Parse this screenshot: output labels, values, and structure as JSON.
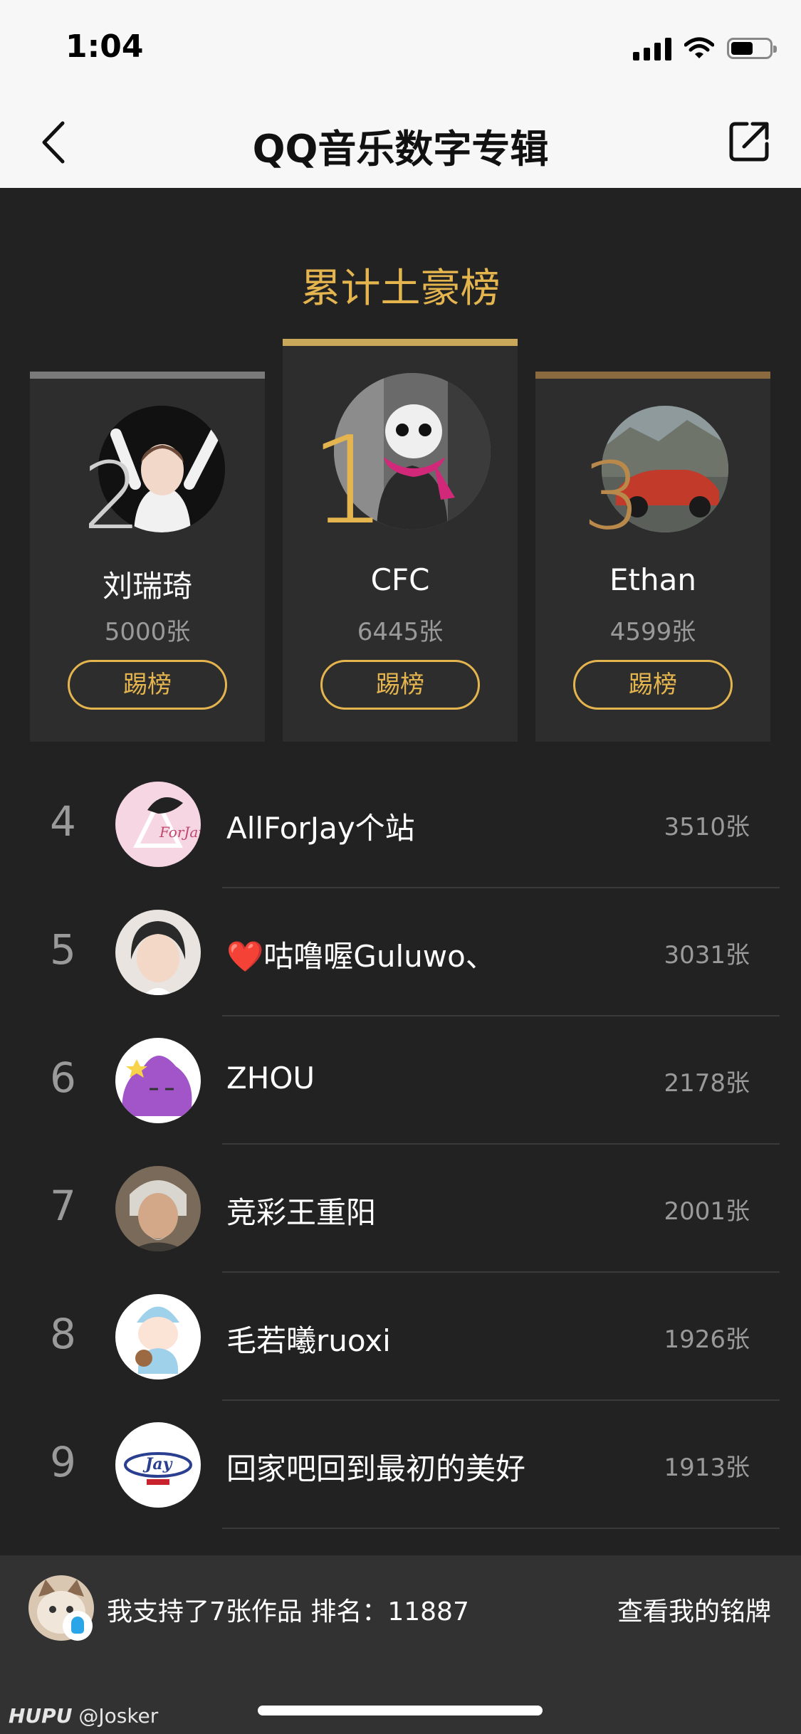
{
  "status": {
    "time": "1:04"
  },
  "nav": {
    "title": "QQ音乐数字专辑"
  },
  "board": {
    "title": "累计土豪榜",
    "kick_label": "踢榜",
    "top3": [
      {
        "rank": "2",
        "name": "刘瑞琦",
        "count": "5000张",
        "accent": "#7a7a7a"
      },
      {
        "rank": "1",
        "name": "CFC",
        "count": "6445张",
        "accent": "#c9a85a"
      },
      {
        "rank": "3",
        "name": "Ethan",
        "count": "4599张",
        "accent": "#8a6a3e"
      }
    ]
  },
  "list": [
    {
      "rank": "4",
      "name": "AllForJay个站",
      "count": "3510张"
    },
    {
      "rank": "5",
      "name": "❤️咕噜喔Guluwo、",
      "count": "3031张"
    },
    {
      "rank": "6",
      "name": "ZHOU",
      "count": "2178张"
    },
    {
      "rank": "7",
      "name": "竞彩王重阳",
      "count": "2001张"
    },
    {
      "rank": "8",
      "name": "毛若曦ruoxi",
      "count": "1926张"
    },
    {
      "rank": "9",
      "name": "回家吧回到最初的美好",
      "count": "1913张"
    }
  ],
  "footer": {
    "summary": "我支持了7张作品 排名：11887",
    "link": "查看我的铭牌"
  },
  "watermark": {
    "brand": "HUPU",
    "user": "@Josker"
  },
  "colors": {
    "gold": "#e4b44f",
    "background": "#222222",
    "card": "#2d2d2d"
  }
}
